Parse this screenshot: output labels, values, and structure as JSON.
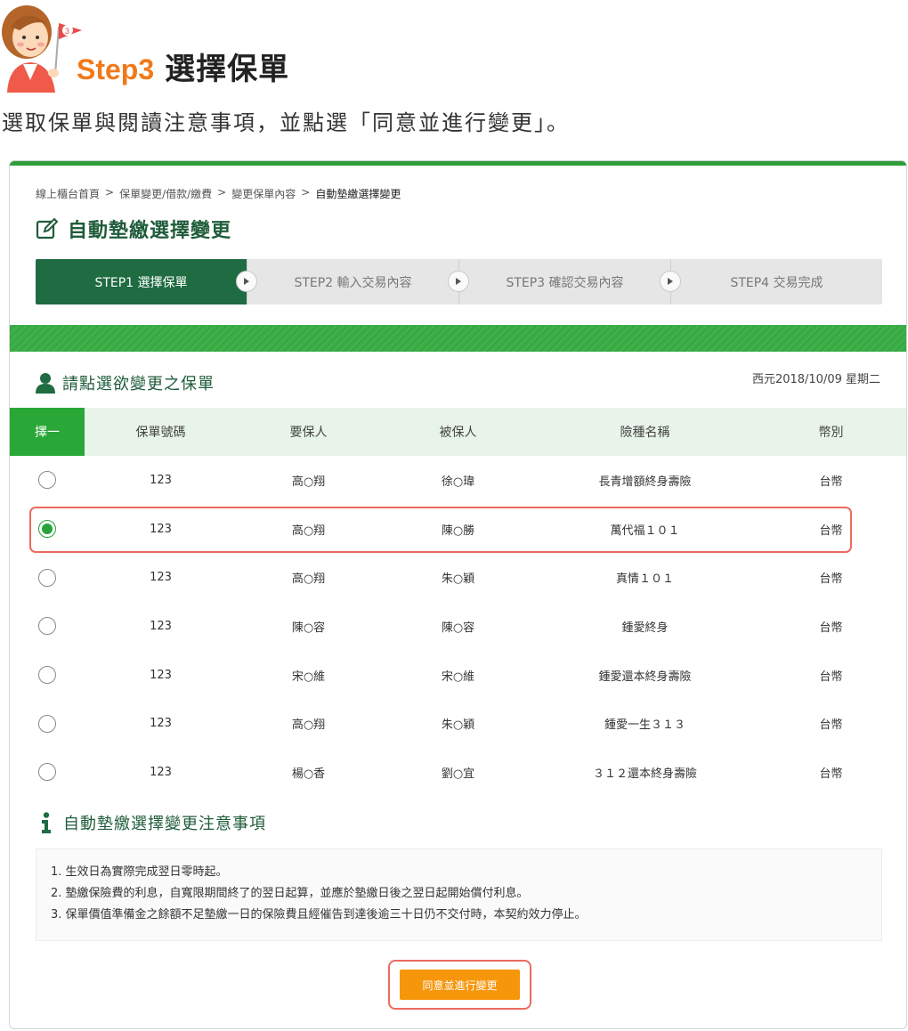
{
  "tutorial": {
    "step_no": "Step3",
    "step_title": "選擇保單",
    "instruction": "選取保單與閱讀注意事項，並點選「同意並進行變更」。",
    "badge": "3"
  },
  "breadcrumb": {
    "items": [
      "線上櫃台首頁",
      "保單變更/借款/繳費",
      "變更保單內容"
    ],
    "current": "自動墊繳選擇變更",
    "separator": ">"
  },
  "page_title": "自動墊繳選擇變更",
  "stepper": {
    "steps": [
      {
        "label": "STEP1 選擇保單",
        "active": true
      },
      {
        "label": "STEP2 輸入交易內容",
        "active": false
      },
      {
        "label": "STEP3 確認交易內容",
        "active": false
      },
      {
        "label": "STEP4 交易完成",
        "active": false
      }
    ]
  },
  "section": {
    "title": "請點選欲變更之保單",
    "date": "西元2018/10/09 星期二"
  },
  "table": {
    "headers": [
      "擇一",
      "保單號碼",
      "要保人",
      "被保人",
      "險種名稱",
      "幣別"
    ],
    "rows": [
      {
        "selected": false,
        "policy_no": "123",
        "applicant": "高○翔",
        "insured": "徐○瑋",
        "plan": "長青增額終身壽險",
        "currency": "台幣"
      },
      {
        "selected": true,
        "policy_no": "123",
        "applicant": "高○翔",
        "insured": "陳○勝",
        "plan": "萬代福１０１",
        "currency": "台幣"
      },
      {
        "selected": false,
        "policy_no": "123",
        "applicant": "高○翔",
        "insured": "朱○穎",
        "plan": "真情１０１",
        "currency": "台幣"
      },
      {
        "selected": false,
        "policy_no": "123",
        "applicant": "陳○容",
        "insured": "陳○容",
        "plan": "鍾愛終身",
        "currency": "台幣"
      },
      {
        "selected": false,
        "policy_no": "123",
        "applicant": "宋○維",
        "insured": "宋○維",
        "plan": "鍾愛還本終身壽險",
        "currency": "台幣"
      },
      {
        "selected": false,
        "policy_no": "123",
        "applicant": "高○翔",
        "insured": "朱○穎",
        "plan": "鍾愛一生３１３",
        "currency": "台幣"
      },
      {
        "selected": false,
        "policy_no": "123",
        "applicant": "楊○香",
        "insured": "劉○宜",
        "plan": "３１２還本終身壽險",
        "currency": "台幣"
      }
    ]
  },
  "notes": {
    "title": "自動墊繳選擇變更注意事項",
    "items": [
      "1. 生效日為實際完成翌日零時起。",
      "2. 墊繳保險費的利息，自寬限期間終了的翌日起算，並應於墊繳日後之翌日起開始償付利息。",
      "3. 保單價值準備金之餘額不足墊繳一日的保險費且經催告到達後逾三十日仍不交付時，本契約效力停止。"
    ]
  },
  "agree_button": "同意並進行變更",
  "colors": {
    "brand_green": "#1f6b42",
    "accent_green": "#29a837",
    "orange": "#f6960b",
    "highlight": "#ec6a5e"
  }
}
